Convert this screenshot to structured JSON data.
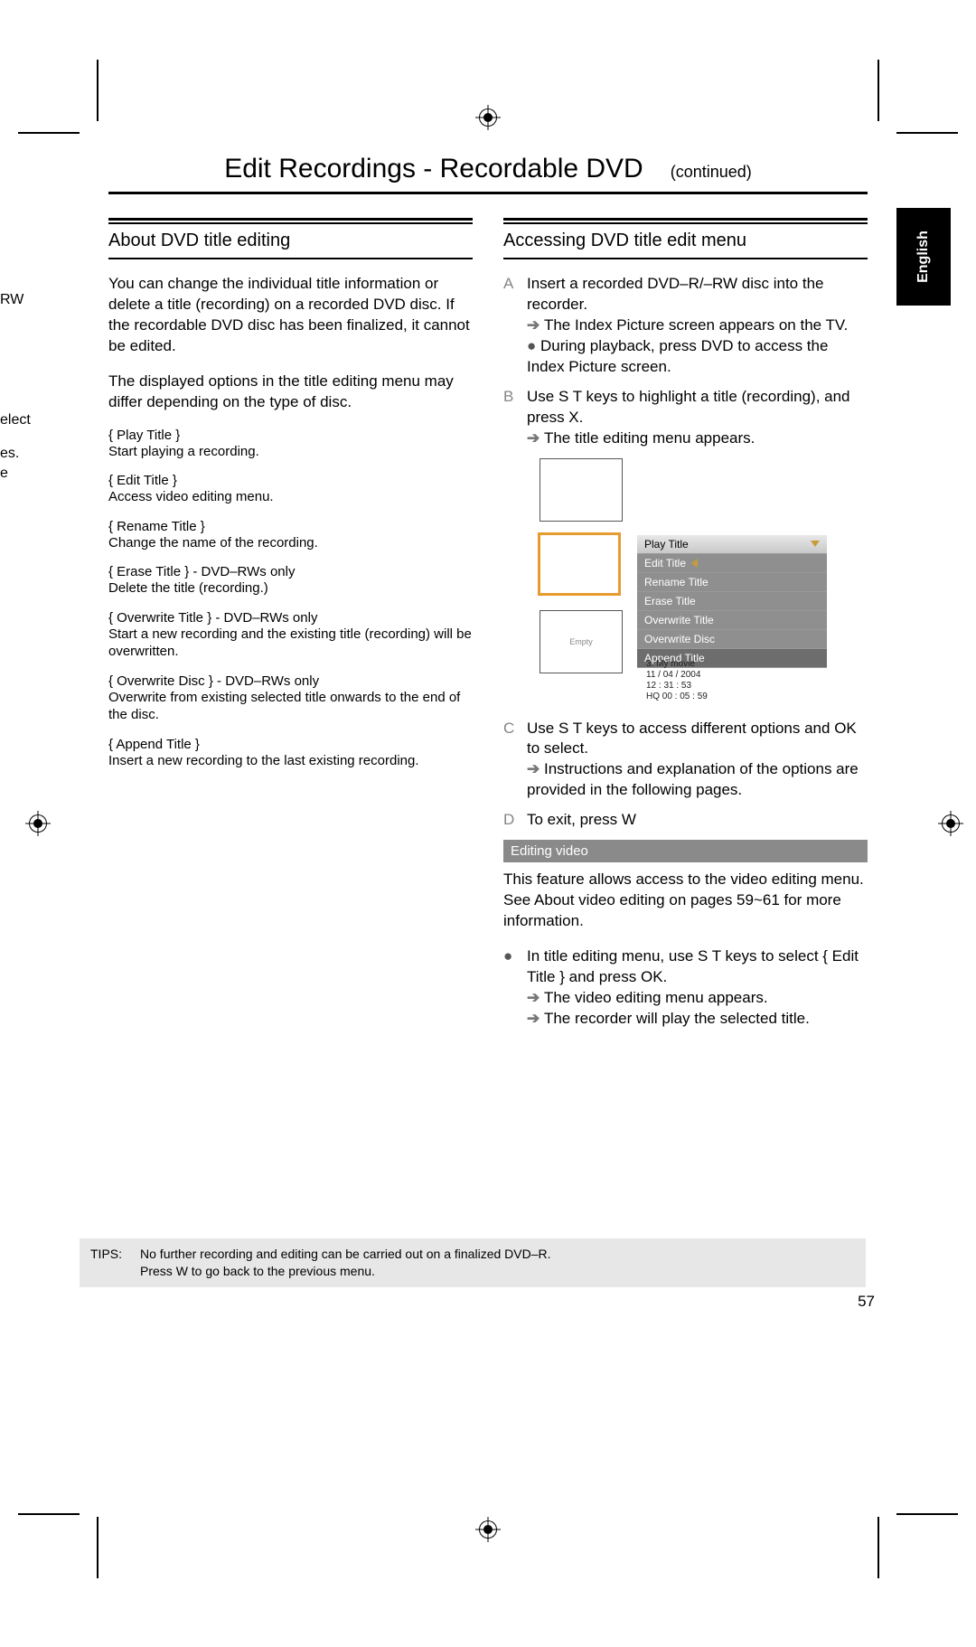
{
  "title": "Edit Recordings - Recordable DVD",
  "continued": "(continued)",
  "lang_tab": "English",
  "page_number": "57",
  "margin_fragments": {
    "f1": "RW",
    "f2": "elect",
    "f3": "es.",
    "f4": "e"
  },
  "left": {
    "heading": "About DVD title editing",
    "intro1": "You can change the individual title information or delete a title (recording) on a recorded DVD disc. If the recordable DVD disc has been finalized, it cannot be edited.",
    "intro2": "The displayed options in the title editing menu may differ depending on the type of disc.",
    "options": [
      {
        "title": "{ Play Title }",
        "desc": "Start playing a recording."
      },
      {
        "title": "{ Edit Title }",
        "desc": "Access video editing menu."
      },
      {
        "title": "{ Rename Title }",
        "desc": "Change the name of the recording."
      },
      {
        "title": "{ Erase Title } - DVD–RWs only",
        "desc": "Delete the title (recording.)"
      },
      {
        "title": "{ Overwrite Title } - DVD–RWs only",
        "desc": "Start a new recording and the existing title (recording) will be overwritten."
      },
      {
        "title": "{ Overwrite Disc } - DVD–RWs only",
        "desc": "Overwrite from existing selected title onwards to the end of the disc."
      },
      {
        "title": "{ Append Title }",
        "desc": "Insert a new recording to the last existing recording."
      }
    ]
  },
  "right": {
    "heading": "Accessing DVD title edit menu",
    "stepA": {
      "letter": "A",
      "line1": "Insert a recorded DVD–R/–RW disc into the recorder.",
      "line2_pre": "➔ ",
      "line2": "The Index Picture screen appears on the TV.",
      "line3_pre": "● ",
      "line3": "During playback, press DVD to access the Index Picture screen."
    },
    "stepB": {
      "letter": "B",
      "line1": "Use S T keys to highlight a title (recording), and press X.",
      "line2_pre": "➔ ",
      "line2": "The title editing menu appears."
    },
    "menu": {
      "rows": [
        "Play Title",
        "Edit Title",
        "Rename Title",
        "Erase Title",
        "Overwrite Title",
        "Overwrite Disc",
        "Append Title"
      ],
      "empty_label": "Empty",
      "meta": [
        "3. My movie",
        "11 / 04 / 2004",
        "12 : 31 : 53",
        "HQ 00 : 05 : 59"
      ]
    },
    "stepC": {
      "letter": "C",
      "line1": "Use S T keys to access different options and OK to select.",
      "line2_pre": "➔ ",
      "line2": "Instructions and explanation of the options are provided in the following pages."
    },
    "stepD": {
      "letter": "D",
      "line1": "To exit, press W"
    },
    "editing_video": {
      "bar": "Editing video",
      "p": "This feature allows access to the video editing menu. See About video editing on pages 59~61 for more information.",
      "bul_pre": "● ",
      "bul": "In title editing menu, use S T keys to select { Edit Title } and press OK.",
      "a1_pre": "➔ ",
      "a1": "The video editing menu appears.",
      "a2_pre": "➔ ",
      "a2": "The recorder will play the selected title."
    }
  },
  "tips": {
    "label": "TIPS:",
    "line1": "No further recording and editing can be carried out on a finalized DVD–R.",
    "line2": "Press W to go back to the previous menu."
  }
}
